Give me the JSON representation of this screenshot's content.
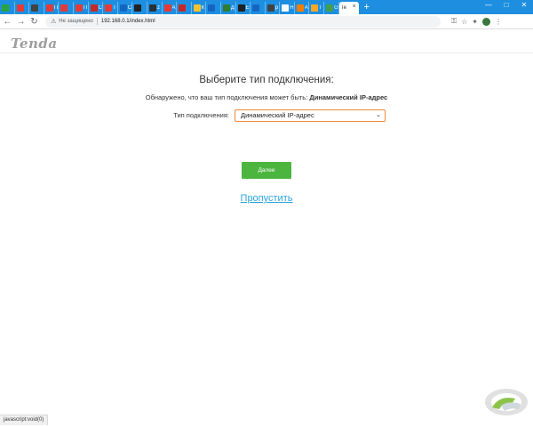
{
  "browser": {
    "tabs": [
      {
        "title": "",
        "color": "#2aa33a"
      },
      {
        "title": "",
        "color": "#e53935"
      },
      {
        "title": "",
        "color": "#424242"
      },
      {
        "title": "П",
        "color": "#e53935"
      },
      {
        "title": "",
        "color": "#e53935"
      },
      {
        "title": "П",
        "color": "#e53935"
      },
      {
        "title": "С",
        "color": "#c62828"
      },
      {
        "title": "Т",
        "color": "#e53935"
      },
      {
        "title": "С",
        "color": "#1565c0"
      },
      {
        "title": "",
        "color": "#212121"
      },
      {
        "title": "z",
        "color": "#263238"
      },
      {
        "title": "A",
        "color": "#e53935"
      },
      {
        "title": "",
        "color": "#c62828"
      },
      {
        "title": "К",
        "color": "#fbc02d"
      },
      {
        "title": "",
        "color": "#1565c0"
      },
      {
        "title": "Д",
        "color": "#2e7d32"
      },
      {
        "title": "Е",
        "color": "#212121"
      },
      {
        "title": "",
        "color": "#1565c0"
      },
      {
        "title": "р",
        "color": "#424242"
      },
      {
        "title": "Н",
        "color": "#ffffff"
      },
      {
        "title": "А",
        "color": "#f57c00"
      },
      {
        "title": "Г",
        "color": "#f9a825"
      },
      {
        "title": "G",
        "color": "#43a047"
      }
    ],
    "active_tab": {
      "title": "Te",
      "close": "×"
    },
    "new_tab": "+",
    "window_controls": {
      "minimize": "—",
      "maximize": "□",
      "close": "✕"
    },
    "nav": {
      "back": "←",
      "forward": "→",
      "reload": "↻"
    },
    "address": {
      "security_icon": "⚠",
      "security_text": "Не защищено",
      "url": "192.168.0.1/index.html"
    },
    "toolbar_icons": {
      "key": "⚿",
      "star": "☆",
      "puzzle": "✦",
      "menu": "⋮",
      "avatar": "A"
    }
  },
  "page": {
    "logo": "Tenda",
    "heading": "Выберите тип подключения:",
    "detected_prefix": "Обнаружено, что ваш тип подключения может быть:",
    "detected_value": "Динамический IP-адрес",
    "type_label": "Тип подключения:",
    "type_selected": "Динамический IP-адрес",
    "next_button": "Далее",
    "skip_link": "Пропустить"
  },
  "status_bar": "javascript:void(0)",
  "colors": {
    "tabstrip": "#1e8fe0",
    "button_green": "#4cb53f",
    "link_blue": "#2ba4dc",
    "select_border": "#f08a3c"
  }
}
